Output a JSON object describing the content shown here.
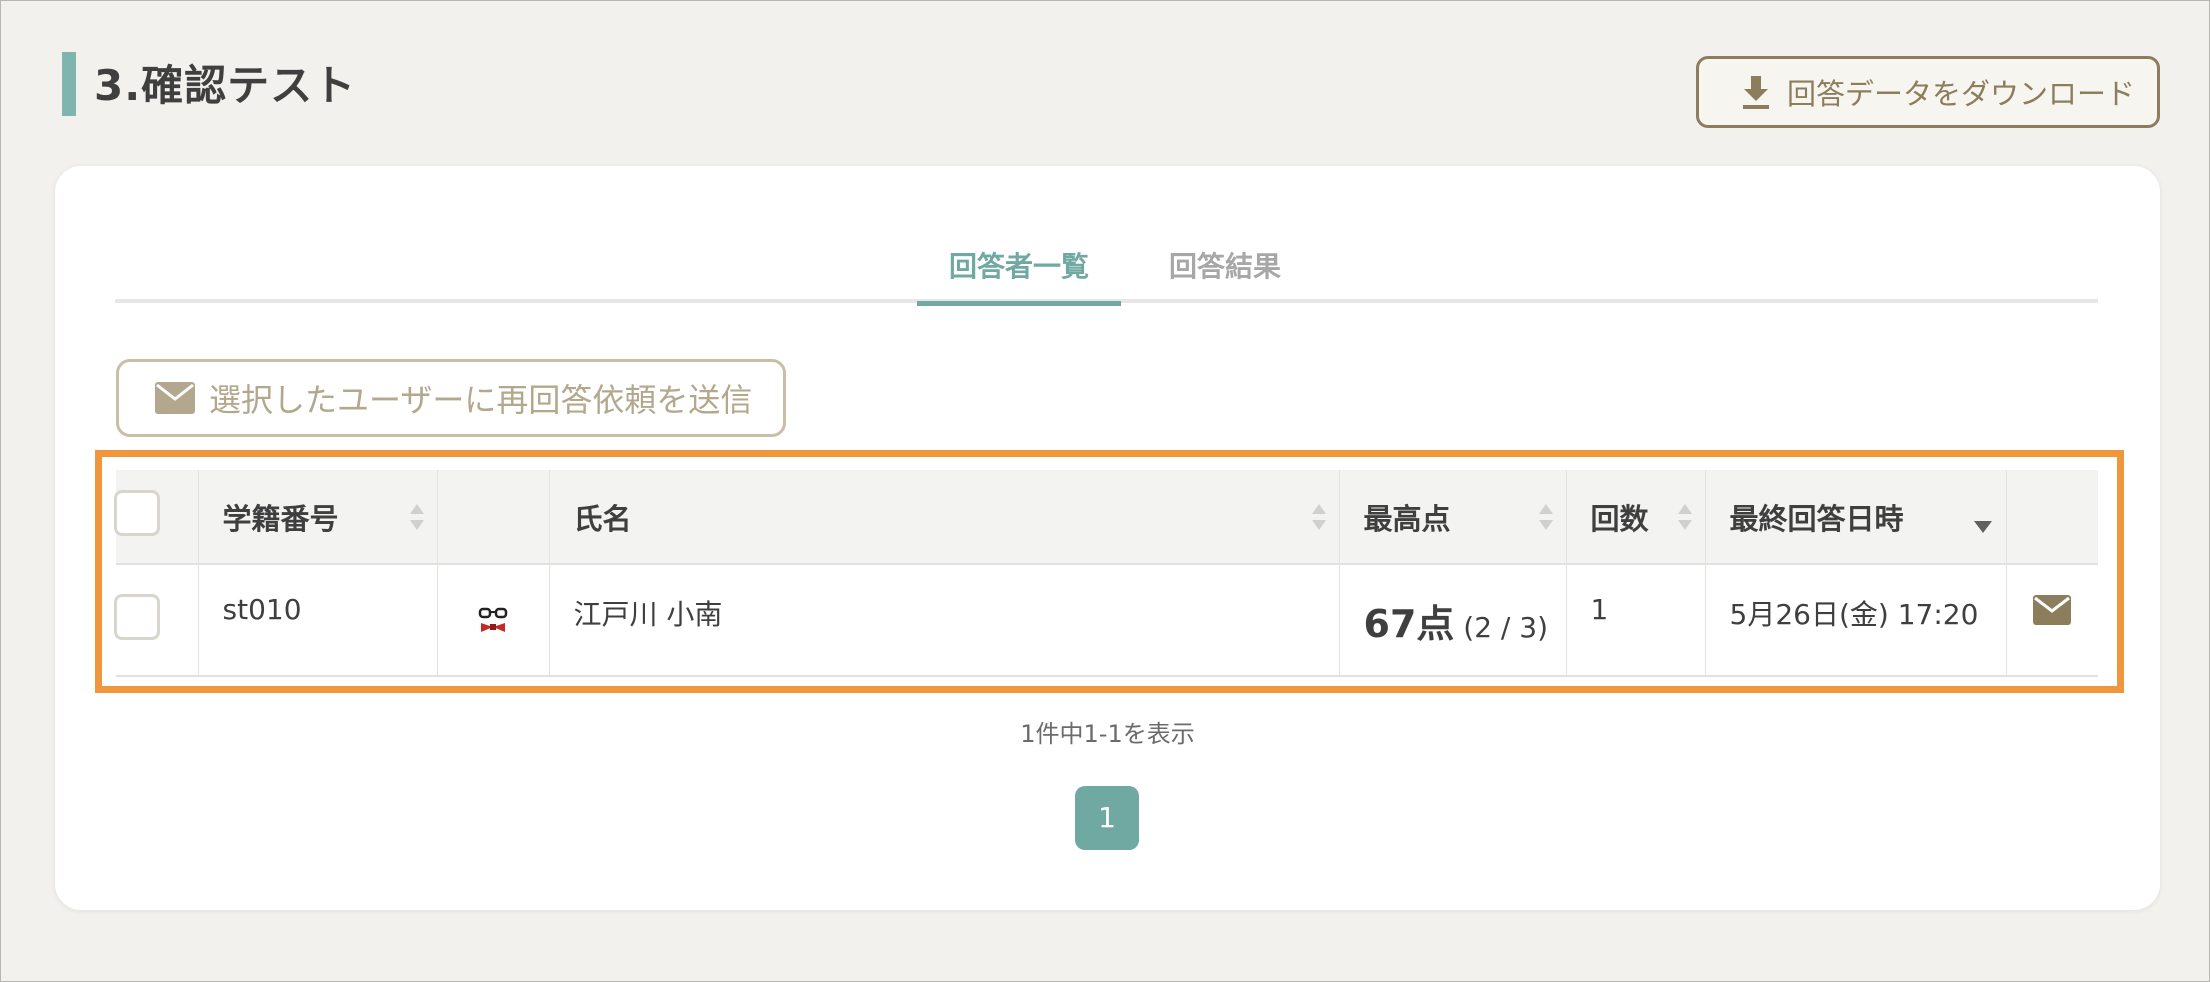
{
  "header": {
    "title": "3.確認テスト",
    "download_label": "回答データをダウンロード"
  },
  "tabs": [
    {
      "label": "回答者一覧",
      "active": true
    },
    {
      "label": "回答結果",
      "active": false
    }
  ],
  "actions": {
    "resend_label": "選択したユーザーに再回答依頼を送信"
  },
  "table": {
    "columns": [
      "学籍番号",
      "氏名",
      "最高点",
      "回数",
      "最終回答日時"
    ],
    "rows": [
      {
        "student_id": "st010",
        "name": "江戸川 小南",
        "score_main": "67点",
        "score_detail": "(2 / 3)",
        "attempts": "1",
        "last_answered": "5月26日(金) 17:20"
      }
    ]
  },
  "pagination": {
    "summary": "1件中1-1を表示",
    "current_page": "1"
  },
  "colors": {
    "accent": "#6fa9a2",
    "button_border": "#8c7d5d",
    "highlight": "#f0963c"
  },
  "icons": {
    "download": "download-icon",
    "mail": "mail-icon",
    "avatar": "glasses-bowtie-avatar-icon"
  }
}
